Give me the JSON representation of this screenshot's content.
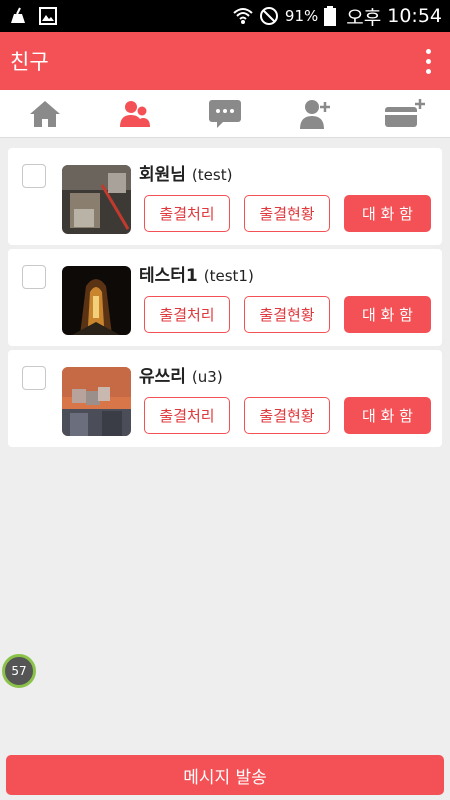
{
  "status_bar": {
    "battery": "91%",
    "time_prefix": "오후",
    "time": "10:54"
  },
  "app_bar": {
    "title": "친구"
  },
  "tabs": [
    {
      "name": "home-icon",
      "active": false
    },
    {
      "name": "friends-icon",
      "active": true
    },
    {
      "name": "chat-icon",
      "active": false
    },
    {
      "name": "add-friend-icon",
      "active": false
    },
    {
      "name": "add-card-icon",
      "active": false
    }
  ],
  "colors": {
    "accent": "#f35155",
    "inactive_icon": "#8a8a8a"
  },
  "friends": [
    {
      "name": "회원님",
      "id": "(test)",
      "btn1": "출결처리",
      "btn2": "출결현황",
      "btn3": "대 화 함"
    },
    {
      "name": "테스터1",
      "id": "(test1)",
      "btn1": "출결처리",
      "btn2": "출결현황",
      "btn3": "대 화 함"
    },
    {
      "name": "유쓰리",
      "id": "(u3)",
      "btn1": "출결처리",
      "btn2": "출결현황",
      "btn3": "대 화 함"
    }
  ],
  "floating_badge": "57",
  "send_button": "메시지 발송"
}
